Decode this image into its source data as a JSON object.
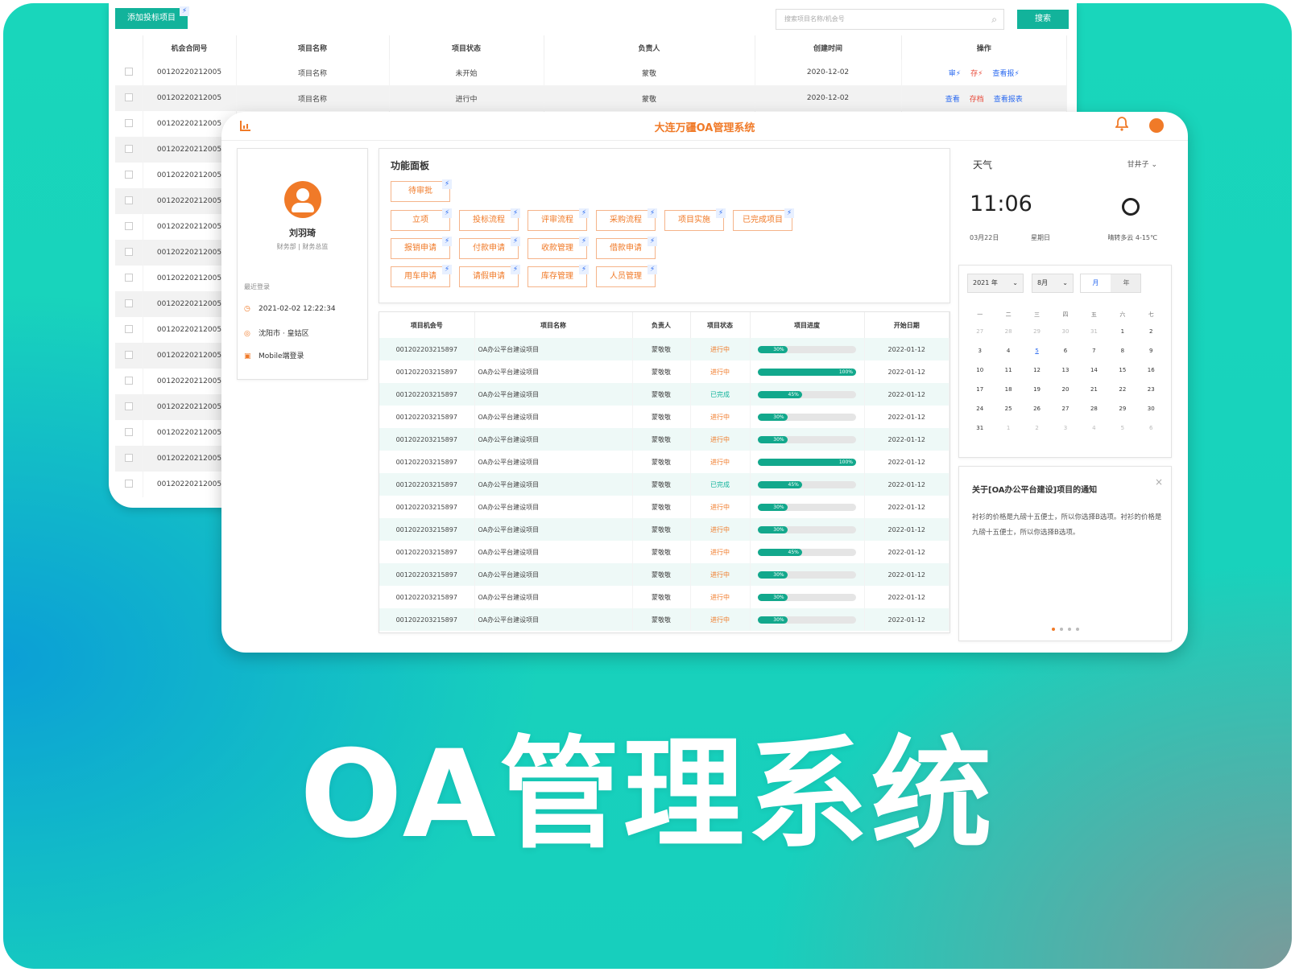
{
  "back": {
    "add_label": "添加投标项目",
    "zap": "⚡",
    "search_placeholder": "搜索项目名称/机会号",
    "search_btn": "搜索",
    "headers": [
      "机会合同号",
      "项目名称",
      "项目状态",
      "负责人",
      "创建时间",
      "操作"
    ],
    "rows": [
      {
        "id": "00120220212005",
        "name": "项目名称",
        "status": "未开始",
        "status_color": "orange",
        "owner": "蒙敬",
        "date": "2020-12-02",
        "ops": [
          "审⚡",
          "存⚡",
          "查看报⚡"
        ]
      },
      {
        "id": "00120220212005",
        "name": "项目名称",
        "status": "进行中",
        "status_color": "green",
        "owner": "蒙敬",
        "date": "2020-12-02",
        "ops": [
          "查看",
          "存档",
          "查看报表"
        ]
      },
      {
        "id": "00120220212005"
      },
      {
        "id": "00120220212005"
      },
      {
        "id": "00120220212005"
      },
      {
        "id": "00120220212005"
      },
      {
        "id": "00120220212005"
      },
      {
        "id": "00120220212005"
      },
      {
        "id": "00120220212005"
      },
      {
        "id": "00120220212005"
      },
      {
        "id": "00120220212005"
      },
      {
        "id": "00120220212005"
      },
      {
        "id": "00120220212005"
      },
      {
        "id": "00120220212005"
      },
      {
        "id": "00120220212005"
      },
      {
        "id": "00120220212005"
      },
      {
        "id": "00120220212005"
      }
    ]
  },
  "front": {
    "title": "大连万疆OA管理系统",
    "profile": {
      "name": "刘羽琦",
      "dept": "财务部 | 财务总监",
      "last_login_label": "最近登录",
      "time": "2021-02-02  12:22:34",
      "location": "沈阳市 · 皇姑区",
      "device": "Mobile端登录"
    },
    "func_title": "功能面板",
    "func_buttons": [
      [
        "待审批"
      ],
      [
        "立项",
        "投标流程",
        "评审流程",
        "采购流程",
        "项目实施",
        "已完成项目"
      ],
      [
        "报销申请",
        "付款申请",
        "收款管理",
        "借款申请"
      ],
      [
        "用车申请",
        "请假申请",
        "库存管理",
        "人员管理"
      ]
    ],
    "proj_headers": [
      "项目机会号",
      "项目名称",
      "负责人",
      "项目状态",
      "项目进度",
      "开始日期"
    ],
    "projects": [
      {
        "id": "001202203215897",
        "name": "OA办公平台建设项目",
        "owner": "蒙敬敬",
        "status": "进行中",
        "color": "orange",
        "progress": 30,
        "date": "2022-01-12"
      },
      {
        "id": "001202203215897",
        "name": "OA办公平台建设项目",
        "owner": "蒙敬敬",
        "status": "进行中",
        "color": "orange",
        "progress": 100,
        "date": "2022-01-12"
      },
      {
        "id": "001202203215897",
        "name": "OA办公平台建设项目",
        "owner": "蒙敬敬",
        "status": "已完成",
        "color": "green",
        "progress": 45,
        "date": "2022-01-12"
      },
      {
        "id": "001202203215897",
        "name": "OA办公平台建设项目",
        "owner": "蒙敬敬",
        "status": "进行中",
        "color": "orange",
        "progress": 30,
        "date": "2022-01-12"
      },
      {
        "id": "001202203215897",
        "name": "OA办公平台建设项目",
        "owner": "蒙敬敬",
        "status": "进行中",
        "color": "orange",
        "progress": 30,
        "date": "2022-01-12"
      },
      {
        "id": "001202203215897",
        "name": "OA办公平台建设项目",
        "owner": "蒙敬敬",
        "status": "进行中",
        "color": "orange",
        "progress": 100,
        "date": "2022-01-12"
      },
      {
        "id": "001202203215897",
        "name": "OA办公平台建设项目",
        "owner": "蒙敬敬",
        "status": "已完成",
        "color": "green",
        "progress": 45,
        "date": "2022-01-12"
      },
      {
        "id": "001202203215897",
        "name": "OA办公平台建设项目",
        "owner": "蒙敬敬",
        "status": "进行中",
        "color": "orange",
        "progress": 30,
        "date": "2022-01-12"
      },
      {
        "id": "001202203215897",
        "name": "OA办公平台建设项目",
        "owner": "蒙敬敬",
        "status": "进行中",
        "color": "orange",
        "progress": 30,
        "date": "2022-01-12"
      },
      {
        "id": "001202203215897",
        "name": "OA办公平台建设项目",
        "owner": "蒙敬敬",
        "status": "进行中",
        "color": "orange",
        "progress": 45,
        "date": "2022-01-12"
      },
      {
        "id": "001202203215897",
        "name": "OA办公平台建设项目",
        "owner": "蒙敬敬",
        "status": "进行中",
        "color": "orange",
        "progress": 30,
        "date": "2022-01-12"
      },
      {
        "id": "001202203215897",
        "name": "OA办公平台建设项目",
        "owner": "蒙敬敬",
        "status": "进行中",
        "color": "orange",
        "progress": 30,
        "date": "2022-01-12"
      },
      {
        "id": "001202203215897",
        "name": "OA办公平台建设项目",
        "owner": "蒙敬敬",
        "status": "进行中",
        "color": "orange",
        "progress": 30,
        "date": "2022-01-12"
      }
    ],
    "weather": {
      "label": "天气",
      "city": "甘井子",
      "time": "11:06",
      "date": "03月22日",
      "weekday": "星期日",
      "cond": "晴转多云  4-15℃"
    },
    "calendar": {
      "year": "2021 年",
      "month": "8月",
      "mode_month": "月",
      "mode_year": "年",
      "weekdays": [
        "一",
        "二",
        "三",
        "四",
        "五",
        "六",
        "七"
      ],
      "weeks": [
        [
          "27",
          "28",
          "29",
          "30",
          "31",
          "1",
          "2"
        ],
        [
          "3",
          "4",
          "5",
          "6",
          "7",
          "8",
          "9"
        ],
        [
          "10",
          "11",
          "12",
          "13",
          "14",
          "15",
          "16"
        ],
        [
          "17",
          "18",
          "19",
          "20",
          "21",
          "22",
          "23"
        ],
        [
          "24",
          "25",
          "26",
          "27",
          "28",
          "29",
          "30"
        ],
        [
          "31",
          "1",
          "2",
          "3",
          "4",
          "5",
          "6"
        ]
      ],
      "today": "5"
    },
    "notice": {
      "title": "关于[OA办公平台建设]项目的通知",
      "body": "衬衫的价格是九磅十五便士，所以你选择B选项。衬衫的价格是九磅十五便士，所以你选择B选项。"
    }
  },
  "hero": "OA管理系统",
  "colors": {
    "accent": "#12b39b",
    "orange": "#f07a28",
    "link": "#2c6bf0"
  }
}
